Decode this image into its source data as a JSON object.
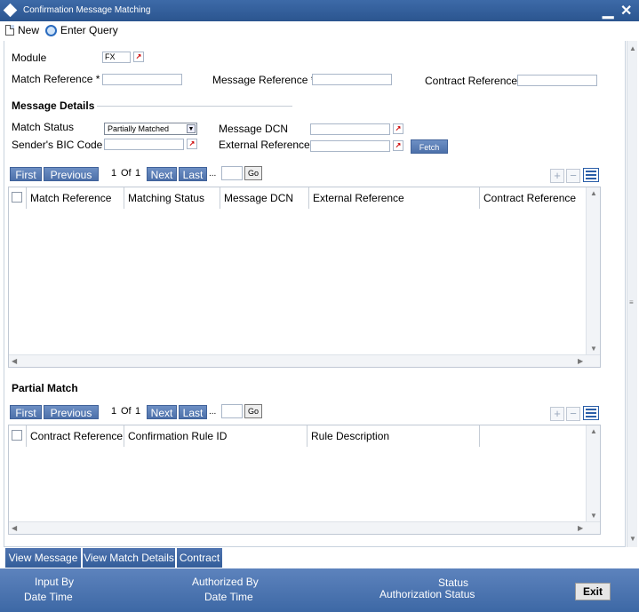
{
  "window": {
    "title": "Confirmation Message Matching",
    "minimize": "▁",
    "close": "✕"
  },
  "toolbar": {
    "new_label": "New",
    "enter_query_label": "Enter Query"
  },
  "form": {
    "module_label": "Module",
    "module_value": "FX",
    "match_reference_label": "Match Reference *",
    "match_reference_value": "",
    "message_reference_label": "Message Reference *",
    "message_reference_value": "",
    "contract_reference_label": "Contract Reference *",
    "contract_reference_value": ""
  },
  "message_details": {
    "title": "Message Details",
    "match_status_label": "Match Status",
    "match_status_value": "Partially Matched",
    "senders_bic_label": "Sender's BIC Code",
    "senders_bic_value": "",
    "message_dcn_label": "Message DCN",
    "message_dcn_value": "",
    "external_reference_label": "External Reference",
    "external_reference_value": "",
    "fetch_label": "Fetch"
  },
  "match_grid": {
    "pager": {
      "first": "First",
      "previous": "Previous",
      "page": "1",
      "of": "Of",
      "total": "1",
      "next": "Next",
      "last": "Last",
      "ellipsis": "...",
      "go": "Go"
    },
    "columns": [
      "Match Reference",
      "Matching Status",
      "Message DCN",
      "External Reference",
      "Contract Reference"
    ],
    "rows": []
  },
  "partial_match": {
    "title": "Partial Match",
    "pager": {
      "first": "First",
      "previous": "Previous",
      "page": "1",
      "of": "Of",
      "total": "1",
      "next": "Next",
      "last": "Last",
      "ellipsis": "...",
      "go": "Go"
    },
    "columns": [
      "Contract Reference",
      "Confirmation Rule ID",
      "Rule Description"
    ],
    "rows": []
  },
  "tabs": [
    "View Message",
    "View Match Details",
    "Contract"
  ],
  "footer": {
    "input_by": "Input By",
    "date_time_1": "Date Time",
    "authorized_by": "Authorized By",
    "date_time_2": "Date Time",
    "status": "Status",
    "authorization_status": "Authorization Status",
    "exit": "Exit"
  },
  "colors": {
    "titlebar": "#2b558f",
    "button_blue": "#4d71aa",
    "footer": "#3d68a5"
  }
}
